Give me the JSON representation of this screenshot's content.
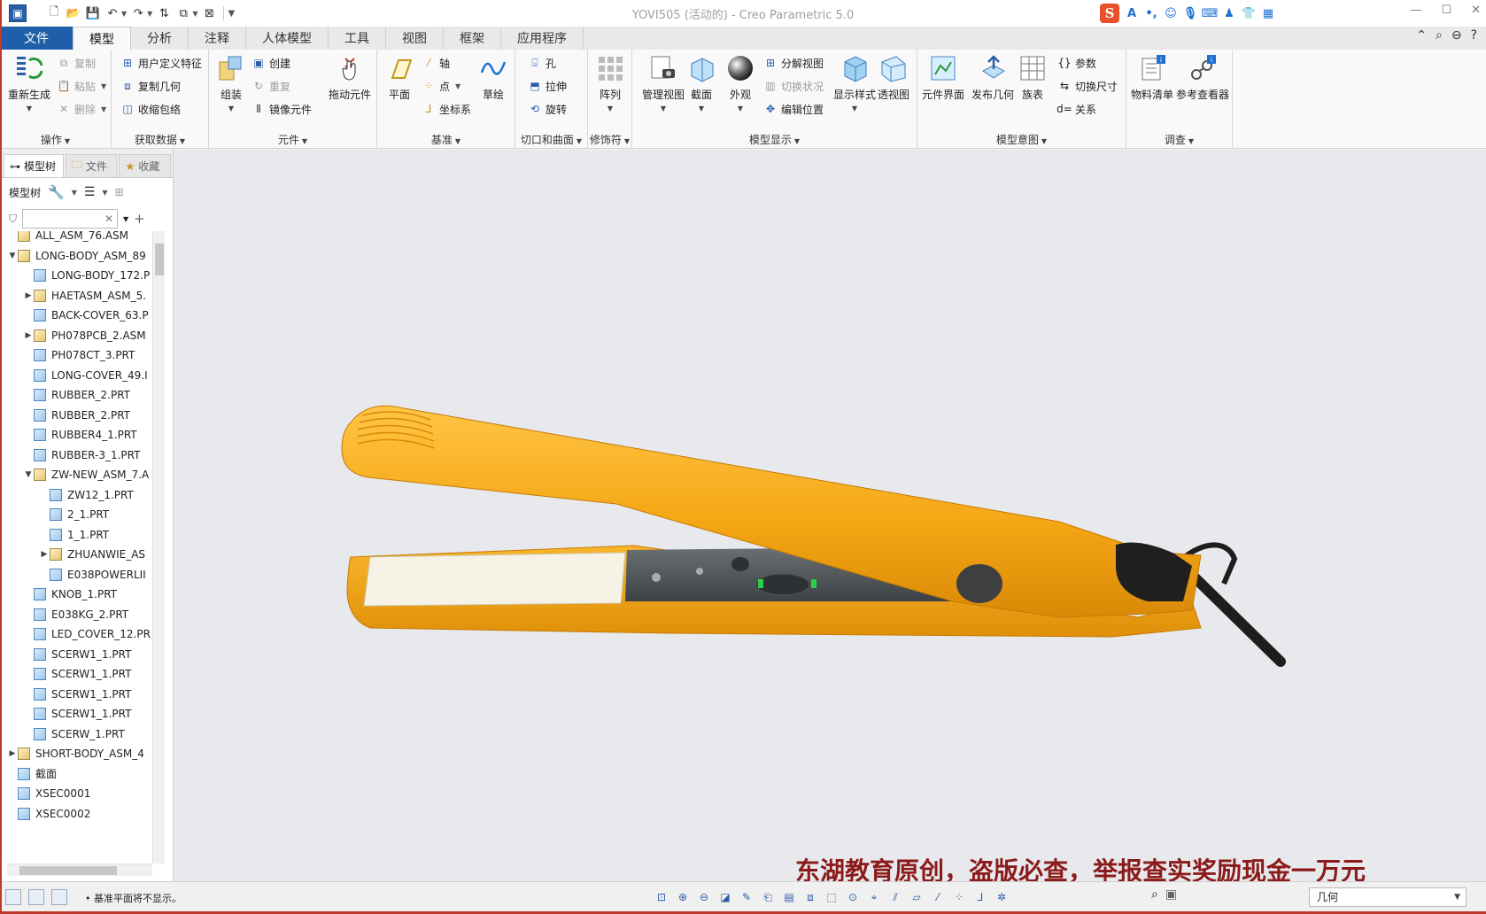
{
  "window": {
    "title": "YOVI505 (活动的) - Creo Parametric 5.0"
  },
  "tabs": [
    {
      "label": "文件"
    },
    {
      "label": "模型"
    },
    {
      "label": "分析"
    },
    {
      "label": "注释"
    },
    {
      "label": "人体模型"
    },
    {
      "label": "工具"
    },
    {
      "label": "视图"
    },
    {
      "label": "框架"
    },
    {
      "label": "应用程序"
    }
  ],
  "ribbon": {
    "operations": {
      "label": "操作",
      "regenerate": "重新生成",
      "copy": "复制",
      "paste": "粘贴",
      "delete": "删除"
    },
    "get_data": {
      "label": "获取数据",
      "udf": "用户定义特征",
      "copy_geom": "复制几何",
      "shrinkwrap": "收缩包络"
    },
    "component": {
      "label": "元件",
      "assemble": "组装",
      "create": "创建",
      "repeat": "重复",
      "mirror": "镜像元件",
      "drag": "拖动元件"
    },
    "datum": {
      "label": "基准",
      "plane": "平面",
      "axis": "轴",
      "point": "点",
      "csys": "坐标系",
      "sketch": "草绘"
    },
    "cuts": {
      "label": "切口和曲面",
      "hole": "孔",
      "extrude": "拉伸",
      "revolve": "旋转"
    },
    "modifiers": {
      "label": "修饰符",
      "pattern": "阵列"
    },
    "model_display": {
      "label": "模型显示",
      "manage_views": "管理视图",
      "section": "截面",
      "appearance": "外观",
      "explode": "分解视图",
      "toggle_status": "切换状况",
      "edit_position": "编辑位置",
      "display_style": "显示样式",
      "perspective": "透视图"
    },
    "model_intent": {
      "label": "模型意图",
      "comp_interface": "元件界面",
      "publish_geom": "发布几何",
      "family_table": "族表",
      "parameters": "参数",
      "switch_dims": "切换尺寸",
      "relations": "关系"
    },
    "investigate": {
      "label": "调查",
      "bom": "物料清单",
      "ref_viewer": "参考查看器"
    }
  },
  "panel": {
    "tabs": [
      "模型树",
      "文件",
      "收藏"
    ],
    "toolbar_label": "模型树",
    "filter_placeholder": ""
  },
  "tree": [
    {
      "name": "ALL_ASM_76.ASM",
      "indent": 0,
      "toggle": "",
      "type": "asm"
    },
    {
      "name": "LONG-BODY_ASM_89",
      "indent": 0,
      "toggle": "▼",
      "type": "asm"
    },
    {
      "name": "LONG-BODY_172.P",
      "indent": 1,
      "toggle": "",
      "type": "prt"
    },
    {
      "name": "HAETASM_ASM_5.",
      "indent": 1,
      "toggle": "▶",
      "type": "asm"
    },
    {
      "name": "BACK-COVER_63.P",
      "indent": 1,
      "toggle": "",
      "type": "prt"
    },
    {
      "name": "PH078PCB_2.ASM",
      "indent": 1,
      "toggle": "▶",
      "type": "asm"
    },
    {
      "name": "PH078CT_3.PRT",
      "indent": 1,
      "toggle": "",
      "type": "prt"
    },
    {
      "name": "LONG-COVER_49.I",
      "indent": 1,
      "toggle": "",
      "type": "prt"
    },
    {
      "name": "RUBBER_2.PRT",
      "indent": 1,
      "toggle": "",
      "type": "prt"
    },
    {
      "name": "RUBBER_2.PRT",
      "indent": 1,
      "toggle": "",
      "type": "prt"
    },
    {
      "name": "RUBBER4_1.PRT",
      "indent": 1,
      "toggle": "",
      "type": "prt"
    },
    {
      "name": "RUBBER-3_1.PRT",
      "indent": 1,
      "toggle": "",
      "type": "prt"
    },
    {
      "name": "ZW-NEW_ASM_7.A",
      "indent": 1,
      "toggle": "▼",
      "type": "asm"
    },
    {
      "name": "ZW12_1.PRT",
      "indent": 2,
      "toggle": "",
      "type": "prt"
    },
    {
      "name": "2_1.PRT",
      "indent": 2,
      "toggle": "",
      "type": "prt"
    },
    {
      "name": "1_1.PRT",
      "indent": 2,
      "toggle": "",
      "type": "prt"
    },
    {
      "name": "ZHUANWIE_AS",
      "indent": 2,
      "toggle": "▶",
      "type": "asm"
    },
    {
      "name": "E038POWERLII",
      "indent": 2,
      "toggle": "",
      "type": "prt"
    },
    {
      "name": "KNOB_1.PRT",
      "indent": 1,
      "toggle": "",
      "type": "prt"
    },
    {
      "name": "E038KG_2.PRT",
      "indent": 1,
      "toggle": "",
      "type": "prt"
    },
    {
      "name": "LED_COVER_12.PR",
      "indent": 1,
      "toggle": "",
      "type": "prt"
    },
    {
      "name": "SCERW1_1.PRT",
      "indent": 1,
      "toggle": "",
      "type": "prt"
    },
    {
      "name": "SCERW1_1.PRT",
      "indent": 1,
      "toggle": "",
      "type": "prt"
    },
    {
      "name": "SCERW1_1.PRT",
      "indent": 1,
      "toggle": "",
      "type": "prt"
    },
    {
      "name": "SCERW1_1.PRT",
      "indent": 1,
      "toggle": "",
      "type": "prt"
    },
    {
      "name": "SCERW_1.PRT",
      "indent": 1,
      "toggle": "",
      "type": "prt"
    },
    {
      "name": "SHORT-BODY_ASM_4",
      "indent": 0,
      "toggle": "▶",
      "type": "asm"
    },
    {
      "name": "截面",
      "indent": -1,
      "toggle": "",
      "type": "prt"
    },
    {
      "name": "XSEC0001",
      "indent": 0,
      "toggle": "",
      "type": "prt"
    },
    {
      "name": "XSEC0002",
      "indent": 0,
      "toggle": "",
      "type": "prt"
    }
  ],
  "status": {
    "message": "• 基准平面将不显示。",
    "filter_value": "几何"
  },
  "watermark": "东湖教育原创，盗版必查，举报查实奖励现金一万元",
  "colors": {
    "file_tab": "#1f5fa9",
    "iron_body": "#f5a614",
    "plate": "#f6f3e6",
    "watermark": "#8b1a1a"
  }
}
